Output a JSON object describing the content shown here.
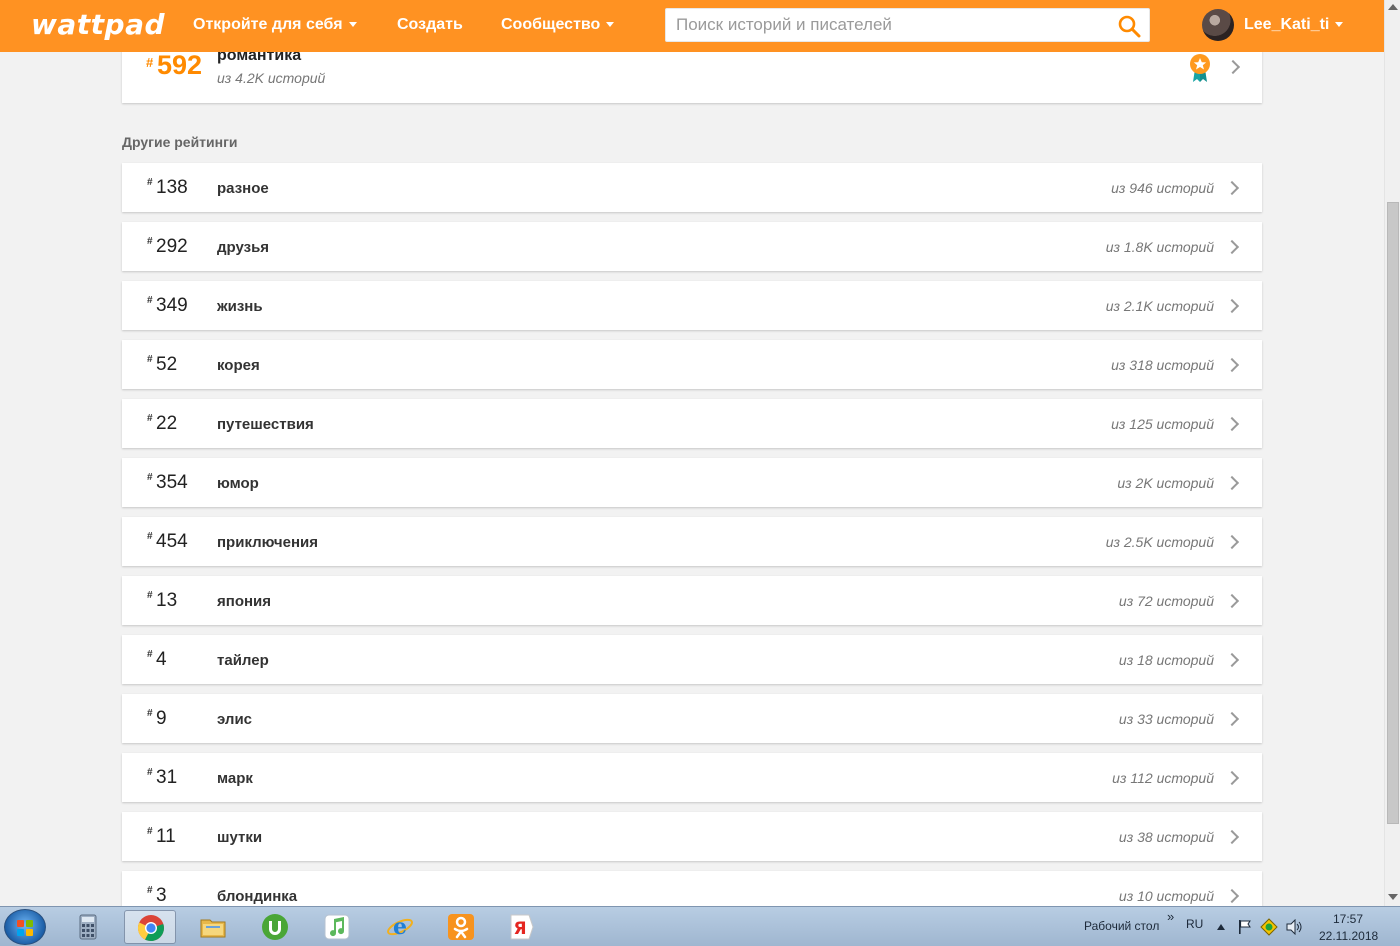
{
  "header": {
    "logo": "wattpad",
    "nav": [
      "Откройте для себя",
      "Создать",
      "Сообщество"
    ],
    "search_placeholder": "Поиск историй и писателей",
    "username": "Lee_Kati_ti"
  },
  "main_ranking": {
    "hash": "#",
    "rank": "592",
    "tag": "романтика",
    "subtitle": "из 4.2K историй"
  },
  "other_title": "Другие рейтинги",
  "rankings": [
    {
      "rank": "138",
      "tag": "разное",
      "count": "из 946 историй"
    },
    {
      "rank": "292",
      "tag": "друзья",
      "count": "из 1.8K историй"
    },
    {
      "rank": "349",
      "tag": "жизнь",
      "count": "из 2.1K историй"
    },
    {
      "rank": "52",
      "tag": "корея",
      "count": "из 318 историй"
    },
    {
      "rank": "22",
      "tag": "путешествия",
      "count": "из 125 историй"
    },
    {
      "rank": "354",
      "tag": "юмор",
      "count": "из 2K историй"
    },
    {
      "rank": "454",
      "tag": "приключения",
      "count": "из 2.5K историй"
    },
    {
      "rank": "13",
      "tag": "япония",
      "count": "из 72 историй"
    },
    {
      "rank": "4",
      "tag": "тайлер",
      "count": "из 18 историй"
    },
    {
      "rank": "9",
      "tag": "элис",
      "count": "из 33 историй"
    },
    {
      "rank": "31",
      "tag": "марк",
      "count": "из 112 историй"
    },
    {
      "rank": "11",
      "tag": "шутки",
      "count": "из 38 историй"
    },
    {
      "rank": "3",
      "tag": "блондинка",
      "count": "из 10 историй"
    }
  ],
  "taskbar": {
    "apps": [
      "calculator-icon",
      "chrome-icon",
      "explorer-icon",
      "utorrent-icon",
      "itunes-icon",
      "internet-explorer-icon",
      "odnoklassniki-icon",
      "yandex-icon"
    ],
    "desktop_label": "Рабочий стол",
    "chevrons": "»",
    "lang": "RU",
    "time": "17:57",
    "date": "22.11.2018"
  },
  "colors": {
    "brand": "#ff9222",
    "rank_accent": "#ff8a00"
  }
}
